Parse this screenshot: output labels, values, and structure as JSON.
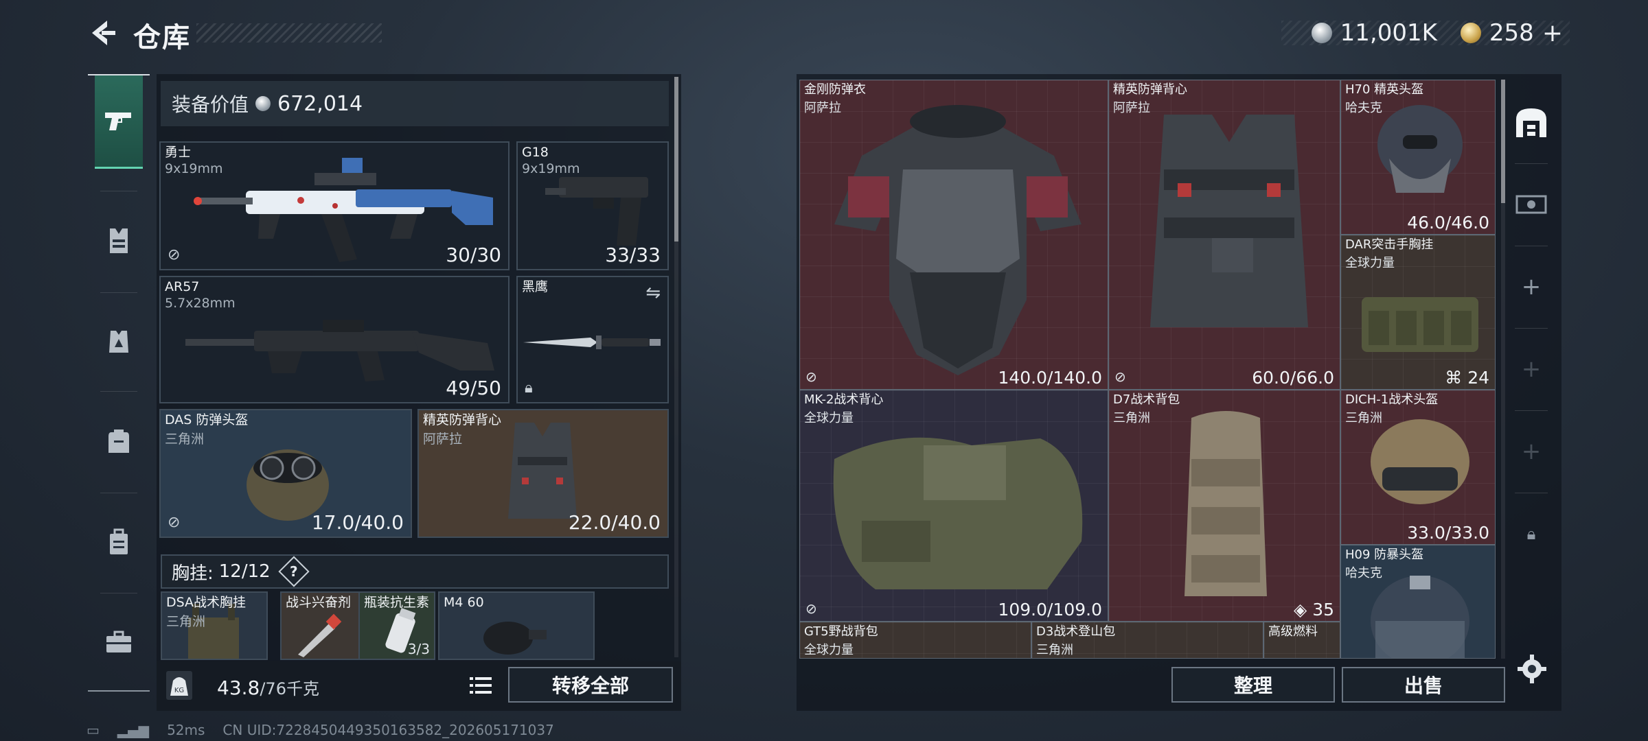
{
  "header": {
    "title": "仓库",
    "currency_silver": "11,001K",
    "currency_gold": "258",
    "plus": "+"
  },
  "left_nav": {
    "items": [
      "pistol-icon",
      "rig-icon",
      "armor-icon",
      "backpack-icon",
      "case-icon",
      "toolbox-icon"
    ]
  },
  "loadout": {
    "value_label": "装备价值",
    "value": "672,014",
    "slots": [
      {
        "name": "勇士",
        "sub": "9x19mm",
        "durability": "30/30"
      },
      {
        "name": "G18",
        "sub": "9x19mm",
        "durability": "33/33"
      },
      {
        "name": "AR57",
        "sub": "5.7x28mm",
        "durability": "49/50"
      },
      {
        "name": "黑鹰",
        "sub": "",
        "durability": ""
      },
      {
        "name": "DAS 防弹头盔",
        "sub": "三角洲",
        "durability": "17.0/40.0"
      },
      {
        "name": "精英防弹背心",
        "sub": "阿萨拉",
        "durability": "22.0/40.0"
      }
    ],
    "rig_label": "胸挂:",
    "rig_count": "12/12",
    "rig_help": "?",
    "rig_items": [
      {
        "name": "DSA战术胸挂",
        "sub": "三角洲"
      },
      {
        "name": "战斗兴奋剂",
        "sub": ""
      },
      {
        "name": "瓶装抗生素",
        "sub": "",
        "count": "3/3"
      },
      {
        "name": "M4 60",
        "sub": ""
      }
    ],
    "weight": "43.8",
    "weight_max": "/76千克",
    "transfer_all": "转移全部"
  },
  "storage": {
    "items": [
      {
        "name": "金刚防弹衣",
        "sub": "阿萨拉",
        "durability": "140.0/140.0"
      },
      {
        "name": "精英防弹背心",
        "sub": "阿萨拉",
        "durability": "60.0/66.0"
      },
      {
        "name": "H70 精英头盔",
        "sub": "哈夫克",
        "durability": "46.0/46.0"
      },
      {
        "name": "DAR突击手胸挂",
        "sub": "全球力量",
        "count": "24"
      },
      {
        "name": "MK-2战术背心",
        "sub": "全球力量",
        "durability": "109.0/109.0"
      },
      {
        "name": "D7战术背包",
        "sub": "三角洲",
        "count": "35"
      },
      {
        "name": "DICH-1战术头盔",
        "sub": "三角洲",
        "durability": "33.0/33.0"
      },
      {
        "name": "H09 防暴头盔",
        "sub": "哈夫克"
      },
      {
        "name": "GT5野战背包",
        "sub": "全球力量"
      },
      {
        "name": "D3战术登山包",
        "sub": "三角洲"
      },
      {
        "name": "高级燃料",
        "sub": ""
      }
    ],
    "sort": "整理",
    "sell": "出售"
  },
  "right_nav": {
    "items": [
      "storage-home-icon",
      "cash-icon",
      "add-icon",
      "add-icon",
      "add-icon",
      "lock-icon"
    ]
  },
  "footer": {
    "ping": "52ms",
    "uid": "CN UID:722845044935016358​2_202605171037"
  },
  "colors": {
    "accent_teal": "#2b6a5b",
    "item_red": "#4a2a31",
    "item_brown": "#3c3430",
    "item_purple": "#2e2d3e",
    "item_slate": "#2a3a4a"
  }
}
